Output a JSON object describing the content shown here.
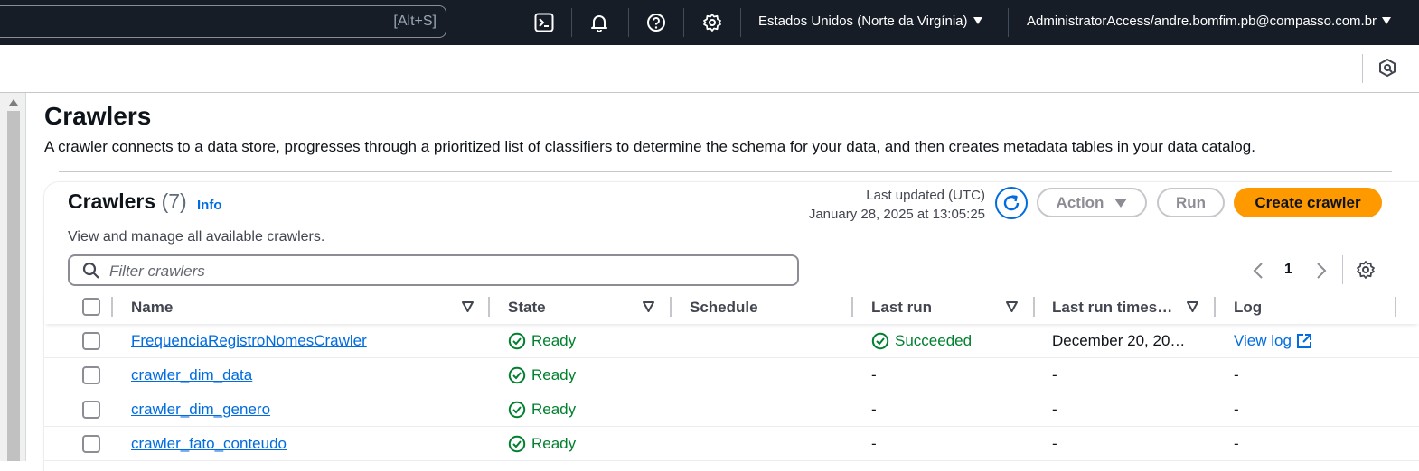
{
  "topnav": {
    "search_hint": "[Alt+S]",
    "region": "Estados Unidos (Norte da Virgínia)",
    "account": "AdministratorAccess/andre.bomfim.pb@compasso.com.br"
  },
  "page": {
    "title": "Crawlers",
    "description": "A crawler connects to a data store, progresses through a prioritized list of classifiers to determine the schema for your data, and then creates metadata tables in your data catalog."
  },
  "card": {
    "title": "Crawlers",
    "count": "(7)",
    "info": "Info",
    "description": "View and manage all available crawlers.",
    "last_updated_label": "Last updated (UTC)",
    "last_updated_value": "January 28, 2025 at 13:05:25",
    "action_label": "Action",
    "run_label": "Run",
    "create_label": "Create crawler",
    "filter_placeholder": "Filter crawlers",
    "page_number": "1"
  },
  "table": {
    "columns": [
      "Name",
      "State",
      "Schedule",
      "Last run",
      "Last run times…",
      "Log"
    ],
    "rows": [
      {
        "name": "FrequenciaRegistroNomesCrawler",
        "state": "Ready",
        "schedule": "",
        "last_run": "Succeeded",
        "last_run_time": "December 20, 20…",
        "log": "View log"
      },
      {
        "name": "crawler_dim_data",
        "state": "Ready",
        "schedule": "",
        "last_run": "-",
        "last_run_time": "-",
        "log": "-"
      },
      {
        "name": "crawler_dim_genero",
        "state": "Ready",
        "schedule": "",
        "last_run": "-",
        "last_run_time": "-",
        "log": "-"
      },
      {
        "name": "crawler_fato_conteudo",
        "state": "Ready",
        "schedule": "",
        "last_run": "-",
        "last_run_time": "-",
        "log": "-"
      }
    ]
  },
  "colors": {
    "nav_bg": "#161d26",
    "link": "#006ce0",
    "success": "#00802f",
    "primary": "#ff9900"
  }
}
